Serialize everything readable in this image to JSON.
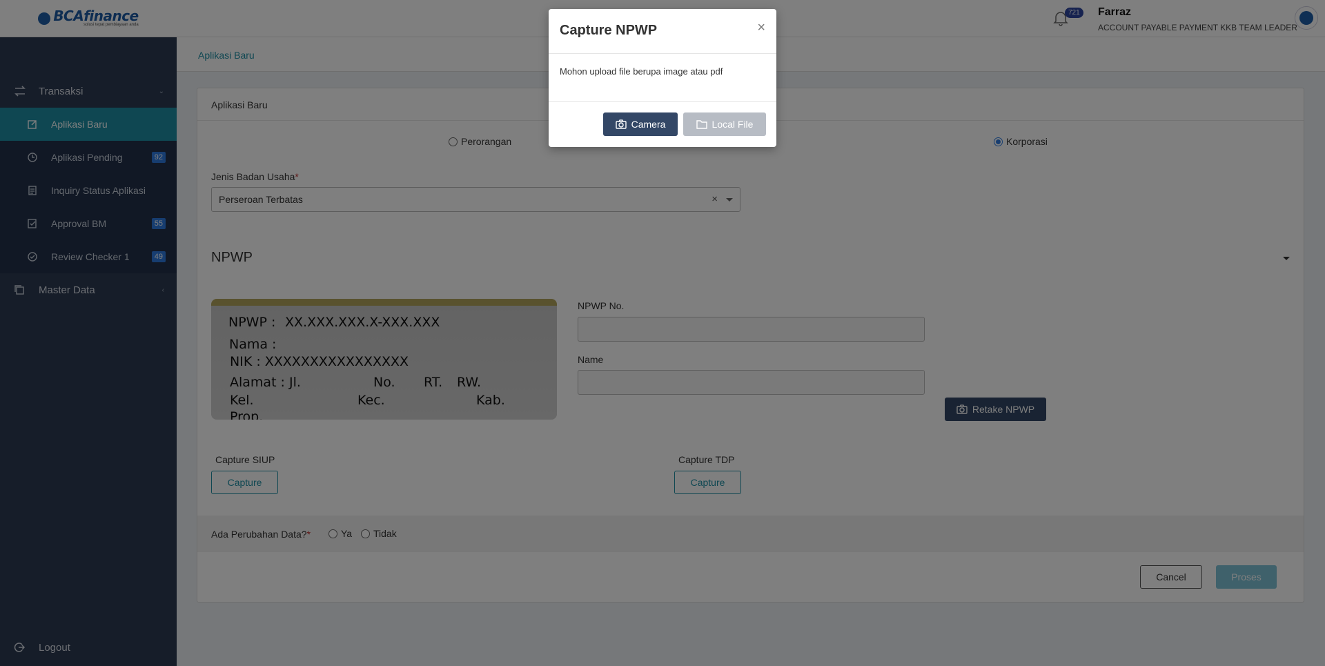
{
  "app": {
    "logo_text": "BCAfinance",
    "logo_tagline": "solusi tepat pembiayaan anda"
  },
  "sidebar": {
    "transaksi_label": "Transaksi",
    "items": [
      {
        "label": "Aplikasi Baru",
        "icon": "edit-icon",
        "active": true
      },
      {
        "label": "Aplikasi Pending",
        "icon": "clock-icon",
        "badge": "92"
      },
      {
        "label": "Inquiry Status Aplikasi",
        "icon": "document-icon"
      },
      {
        "label": "Approval BM",
        "icon": "approve-icon",
        "badge": "55"
      },
      {
        "label": "Review Checker 1",
        "icon": "check-circle-icon",
        "badge": "49"
      }
    ],
    "master_data_label": "Master Data",
    "logout_label": "Logout"
  },
  "header": {
    "notification_count": "721",
    "user_name": "Farraz",
    "user_role": "ACCOUNT PAYABLE PAYMENT KKB TEAM LEADER"
  },
  "breadcrumb": "Aplikasi Baru",
  "form": {
    "card_title": "Aplikasi Baru",
    "type_options": {
      "perorangan": "Perorangan",
      "korporasi": "Korporasi"
    },
    "selected_type": "Korporasi",
    "jenis_label": "Jenis Badan Usaha",
    "jenis_value": "Perseroan Terbatas",
    "section_title": "NPWP",
    "npwp_card": {
      "line1_label": "NPWP :",
      "line1_value": "XX.XXX.XXX.X-XXX.XXX",
      "nama": "Nama :",
      "nik": "NIK    : XXXXXXXXXXXXXXXX",
      "alamat": "Alamat : Jl.",
      "no": "No.",
      "rt": "RT.",
      "rw": "RW.",
      "kel": "Kel.",
      "kec": "Kec.",
      "kab": "Kab.",
      "prop": "Prop."
    },
    "npwp_no_label": "NPWP No.",
    "npwp_no_value": "",
    "name_label": "Name",
    "name_value": "",
    "retake_label": "Retake NPWP",
    "siup_label": "Capture SIUP",
    "tdp_label": "Capture TDP",
    "capture_button": "Capture",
    "perubahan_label": "Ada Perubahan Data?",
    "ya_label": "Ya",
    "tidak_label": "Tidak",
    "cancel_label": "Cancel",
    "proses_label": "Proses"
  },
  "modal": {
    "title": "Capture NPWP",
    "close": "×",
    "message": "Mohon upload file berupa image atau pdf",
    "camera_label": "Camera",
    "local_file_label": "Local File"
  },
  "colors": {
    "sidebar_bg": "#2c3b52",
    "active_item": "#1e8fa5",
    "badge": "#2e7be0",
    "dark_button": "#334766"
  }
}
